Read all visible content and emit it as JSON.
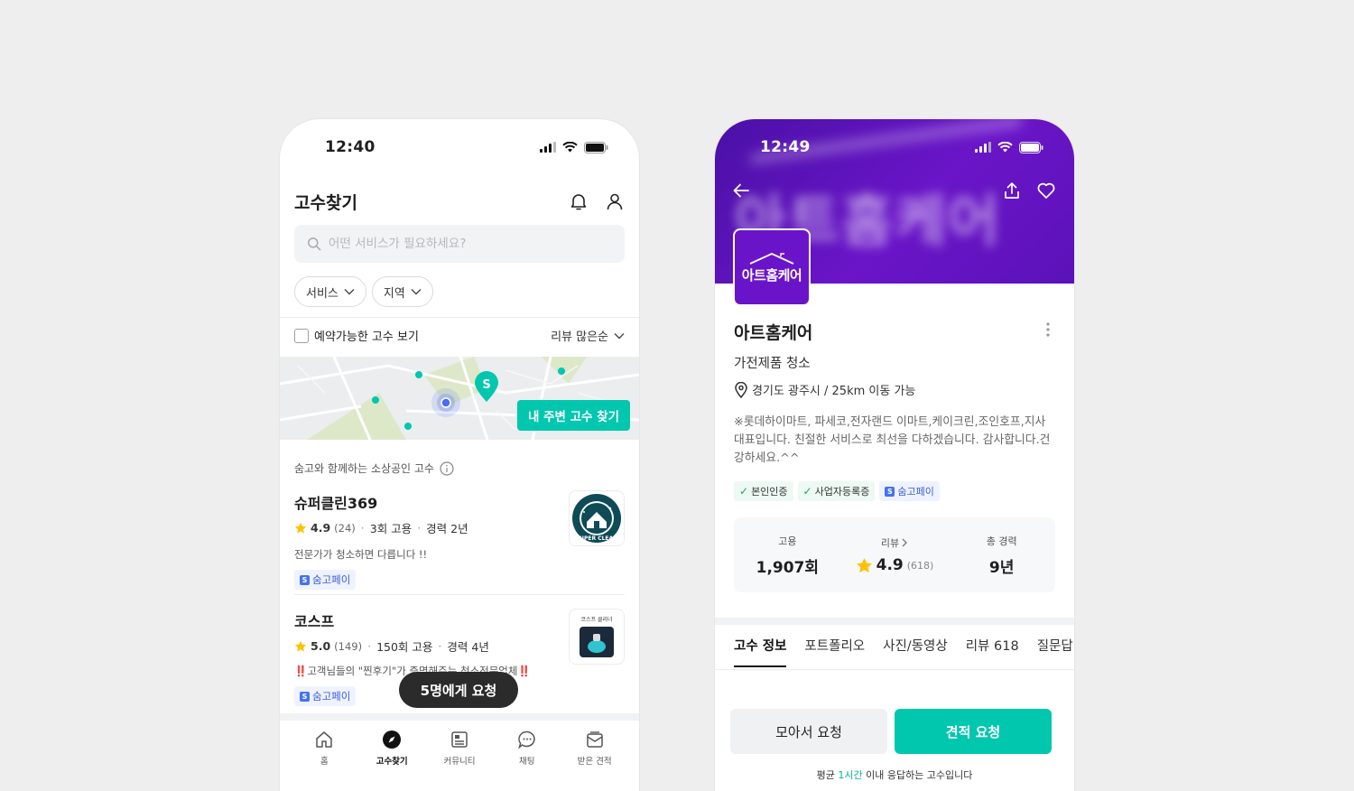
{
  "left": {
    "status_time": "12:40",
    "title": "고수찾기",
    "search_placeholder": "어떤 서비스가 필요하세요?",
    "filters": [
      "서비스",
      "지역"
    ],
    "checkbox_label": "예약가능한 고수 보기",
    "sort_label": "리뷰 많은순",
    "map_button": "내 주변 고수 찾기",
    "section_label": "숨고와 함께하는 소상공인 고수",
    "pros": [
      {
        "name": "슈퍼클린369",
        "rating": "4.9",
        "reviews": "(24)",
        "hires": "3회 고용",
        "career": "경력 2년",
        "desc": "전문가가 청소하면 다릅니다 !!",
        "pay": "숨고페이",
        "thumb_text": "SUPER CLEAN"
      },
      {
        "name": "코스프",
        "rating": "5.0",
        "reviews": "(149)",
        "hires": "150회 고용",
        "career": "경력 4년",
        "desc": "‼️고객님들의 \"찐후기\"가 증명해주는 청소전문업체‼️",
        "pay": "숨고페이",
        "thumb_text": "코스프 클리너"
      }
    ],
    "request_button": "5명에게 요청",
    "tabs": [
      "홈",
      "고수찾기",
      "커뮤니티",
      "채팅",
      "받은 견적"
    ]
  },
  "right": {
    "status_time": "12:49",
    "banner_text": "아트홈케어",
    "logo_text": "아트홈케어",
    "name": "아트홈케어",
    "category": "가전제품 청소",
    "location": "경기도 광주시 / 25km 이동 가능",
    "intro": "※롯데하이마트, 파세코,전자랜드 이마트,케이크린,조인호프,지사 대표입니다.  친절한 서비스로 최선을 다하겠습니다. 감사합니다.건강하세요.^^",
    "badges": [
      "본인인증",
      "사업자등록증",
      "숨고페이"
    ],
    "stats": [
      {
        "label": "고용",
        "value": "1,907회"
      },
      {
        "label": "리뷰",
        "value": "4.9",
        "sub": "(618)"
      },
      {
        "label": "총 경력",
        "value": "9년"
      }
    ],
    "tabs": [
      "고수 정보",
      "포트폴리오",
      "사진/동영상",
      "리뷰 618",
      "질문답"
    ],
    "btn_collect": "모아서 요청",
    "btn_quote": "견적 요청",
    "response_prefix": "평균 ",
    "response_highlight": "1시간",
    "response_suffix": " 이내 응답하는 고수입니다"
  },
  "colors": {
    "accent": "#00c7ae",
    "banner": "#5b12b8",
    "star": "#ffc107",
    "pay_blue": "#3b5bdb"
  }
}
